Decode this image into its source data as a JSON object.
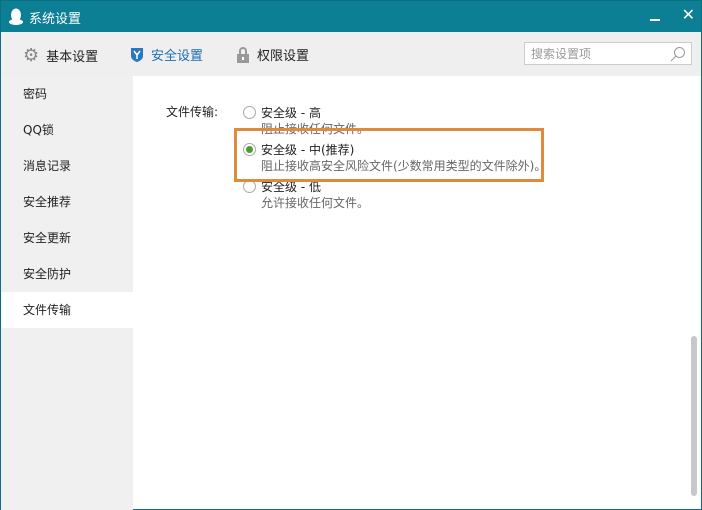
{
  "window": {
    "title": "系统设置"
  },
  "toolbar": {
    "tabs": [
      {
        "label": "基本设置"
      },
      {
        "label": "安全设置"
      },
      {
        "label": "权限设置"
      }
    ],
    "search_placeholder": "搜索设置项"
  },
  "sidebar": {
    "items": [
      {
        "label": "密码"
      },
      {
        "label": "QQ锁"
      },
      {
        "label": "消息记录"
      },
      {
        "label": "安全推荐"
      },
      {
        "label": "安全更新"
      },
      {
        "label": "安全防护"
      },
      {
        "label": "文件传输"
      }
    ]
  },
  "main": {
    "label": "文件传输:",
    "options": [
      {
        "title": "安全级 - 高",
        "desc": "阻止接收任何文件。",
        "selected": false
      },
      {
        "title": "安全级 - 中(推荐)",
        "desc": "阻止接收高安全风险文件(少数常用类型的文件除外)。",
        "selected": true
      },
      {
        "title": "安全级 - 低",
        "desc": "允许接收任何文件。",
        "selected": false
      }
    ]
  },
  "colors": {
    "titlebar": "#0d7f95",
    "accent": "#1b6fb0",
    "highlight": "#e08a3c",
    "radio_on": "#4a9e2e"
  }
}
